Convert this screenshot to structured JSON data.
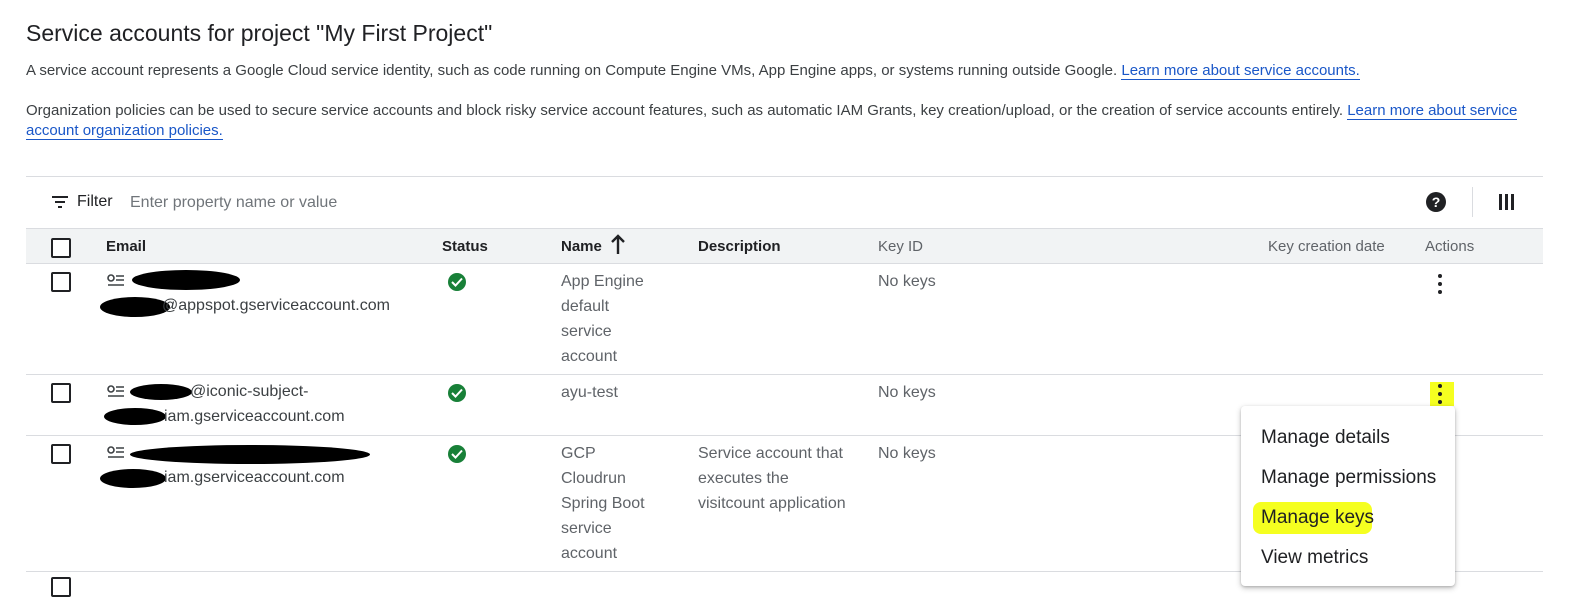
{
  "page": {
    "title": "Service accounts for project \"My First Project\"",
    "description": "A service account represents a Google Cloud service identity, such as code running on Compute Engine VMs, App Engine apps, or systems running outside Google.",
    "description_link": "Learn more about service accounts.",
    "org_policy": "Organization policies can be used to secure service accounts and block risky service account features, such as automatic IAM Grants, key creation/upload, or the creation of service accounts entirely.",
    "org_policy_link": "Learn more about service account organization policies."
  },
  "filter": {
    "label": "Filter",
    "placeholder": "Enter property name or value"
  },
  "table": {
    "columns": {
      "email": "Email",
      "status": "Status",
      "name": "Name",
      "description": "Description",
      "key_id": "Key ID",
      "key_creation_date": "Key creation date",
      "actions": "Actions"
    },
    "rows": [
      {
        "email_line1": "",
        "email_line2": "@appspot.gserviceaccount.com",
        "status": "enabled",
        "name": "App Engine default service account",
        "description": "",
        "key_id": "No keys"
      },
      {
        "email_line1": "@iconic-subject-",
        "email_line2": "iam.gserviceaccount.com",
        "status": "enabled",
        "name": "ayu-test",
        "description": "",
        "key_id": "No keys"
      },
      {
        "email_line1": "",
        "email_line2": "iam.gserviceaccount.com",
        "status": "enabled",
        "name": "GCP Cloudrun Spring Boot service account",
        "description": "Service account that executes the visitcount application",
        "key_id": "No keys"
      }
    ]
  },
  "actions_menu": {
    "items": [
      "Manage details",
      "Manage permissions",
      "Manage keys",
      "View metrics"
    ],
    "highlighted": "Manage keys"
  },
  "colors": {
    "link": "#1a57c8",
    "status_ok": "#188038",
    "highlight": "#f5ff20",
    "header_bg": "#f1f3f4"
  },
  "icons": {
    "filter": "filter-icon",
    "help": "help-icon",
    "columns": "column-display-icon",
    "sort": "arrow-up-icon",
    "key": "service-account-icon",
    "status": "check-circle-icon",
    "more": "more-vert-icon"
  }
}
